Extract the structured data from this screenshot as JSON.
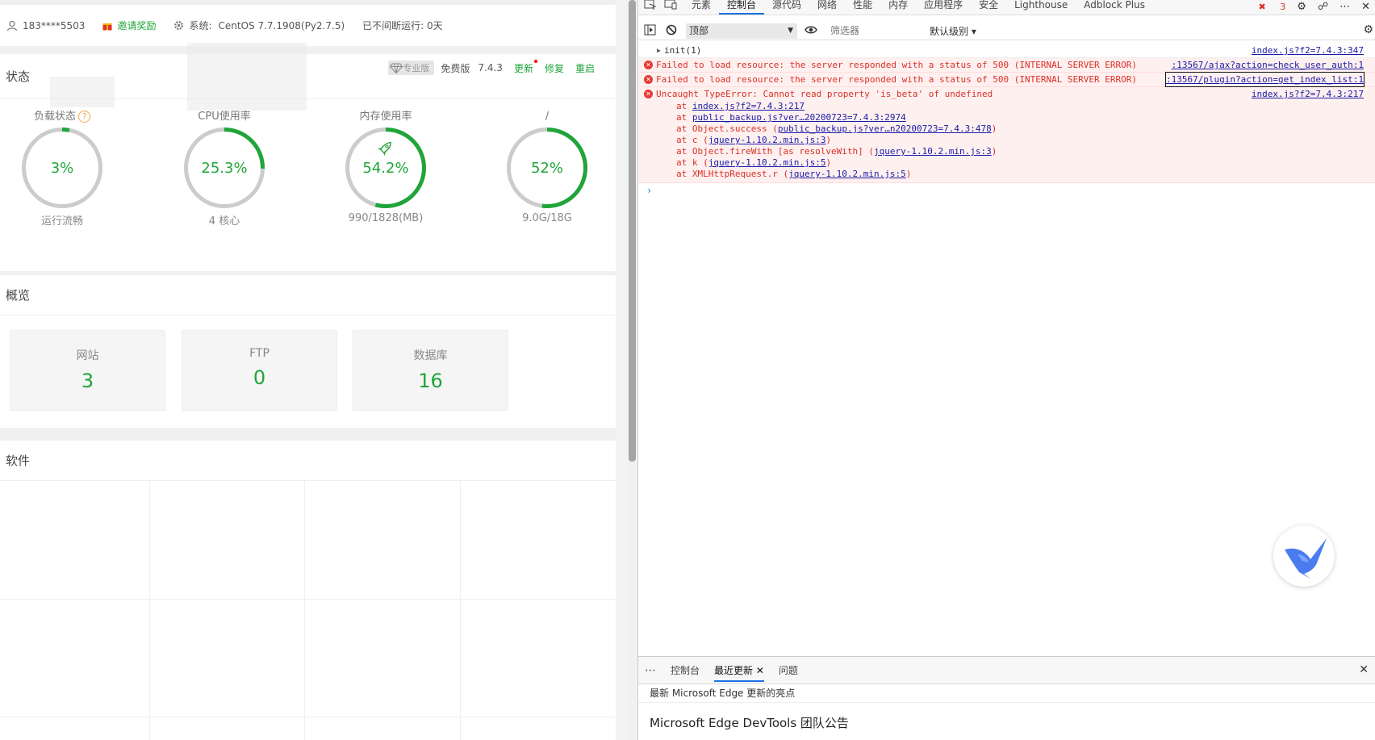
{
  "header": {
    "user": "183****5503",
    "invite": "邀请奖励",
    "system_label": "系统:",
    "system": "CentOS 7.7.1908(Py2.7.5)",
    "uptime": "已不间断运行: 0天"
  },
  "status": {
    "title": "状态",
    "pro_badge": "专业版",
    "edition": "免费版",
    "version": "7.4.3",
    "update": "更新",
    "repair": "修复",
    "restart": "重启",
    "gauges": [
      {
        "label": "负载状态",
        "value": "3%",
        "percent": 3,
        "sub": "运行流畅",
        "help": "?"
      },
      {
        "label": "CPU使用率",
        "value": "25.3%",
        "percent": 25.3,
        "sub": "4 核心"
      },
      {
        "label": "内存使用率",
        "value": "54.2%",
        "percent": 54.2,
        "sub": "990/1828(MB)"
      },
      {
        "label": "/",
        "value": "52%",
        "percent": 52,
        "sub": "9.0G/18G"
      }
    ],
    "colors": {
      "accent": "#20a53a",
      "track": "#cccccc"
    }
  },
  "overview": {
    "title": "概览",
    "items": [
      {
        "label": "网站",
        "value": "3"
      },
      {
        "label": "FTP",
        "value": "0"
      },
      {
        "label": "数据库",
        "value": "16"
      }
    ]
  },
  "software": {
    "title": "软件"
  },
  "devtools": {
    "tabs": [
      "元素",
      "控制台",
      "源代码",
      "网络",
      "性能",
      "内存",
      "应用程序",
      "安全",
      "Lighthouse",
      "Adblock Plus"
    ],
    "active_tab": "控制台",
    "error_count": "3",
    "context": "顶部",
    "filter_placeholder": "筛选器",
    "levels": "默认级别 ▾",
    "logs": {
      "init": "init(1)",
      "init_src": "index.js?f2=7.4.3:347",
      "err1": "Failed to load resource: the server responded with a status of 500 (INTERNAL SERVER ERROR)",
      "err1_src": ":13567/ajax?action=check_user_auth:1",
      "err2": "Failed to load resource: the server responded with a status of 500 (INTERNAL SERVER ERROR)",
      "err2_src": ":13567/plugin?action=get_index_list:1",
      "err3": "Uncaught TypeError: Cannot read property 'is_beta' of undefined",
      "err3_src": "index.js?f2=7.4.3:217",
      "stack": [
        {
          "pre": "at ",
          "link": "index.js?f2=7.4.3:217",
          "post": ""
        },
        {
          "pre": "at ",
          "link": "public_backup.js?ver…20200723=7.4.3:2974",
          "post": ""
        },
        {
          "pre": "at Object.success (",
          "link": "public_backup.js?ver…n20200723=7.4.3:478",
          "post": ")"
        },
        {
          "pre": "at c (",
          "link": "jquery-1.10.2.min.js:3",
          "post": ")"
        },
        {
          "pre": "at Object.fireWith [as resolveWith] (",
          "link": "jquery-1.10.2.min.js:3",
          "post": ")"
        },
        {
          "pre": "at k (",
          "link": "jquery-1.10.2.min.js:5",
          "post": ")"
        },
        {
          "pre": "at XMLHttpRequest.r (",
          "link": "jquery-1.10.2.min.js:5",
          "post": ")"
        }
      ]
    },
    "drawer": {
      "tabs": [
        "控制台",
        "最近更新",
        "问题"
      ],
      "news": "最新 Microsoft Edge 更新的亮点",
      "headline": "Microsoft Edge DevTools 团队公告"
    }
  }
}
